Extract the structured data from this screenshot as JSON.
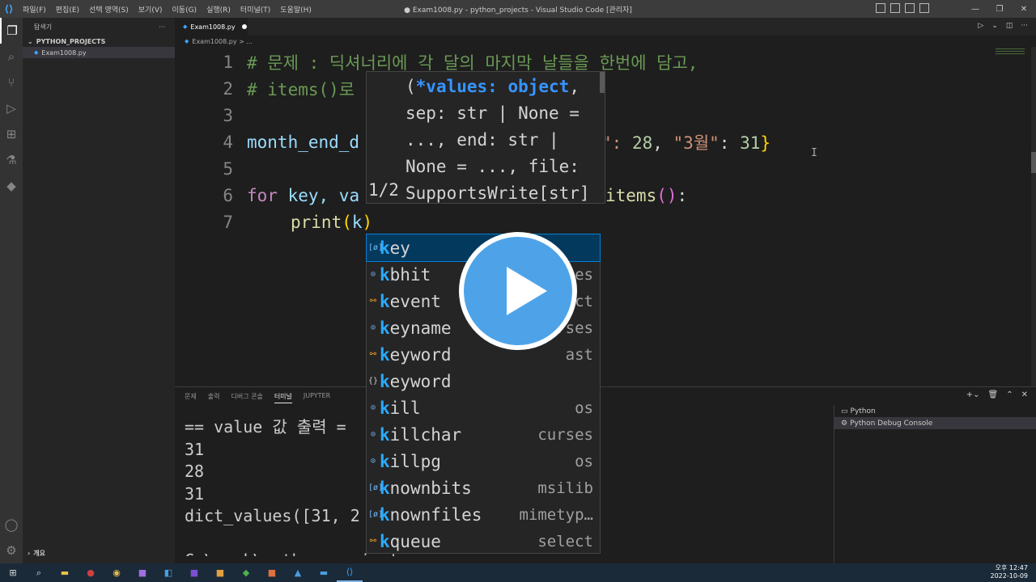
{
  "window": {
    "menu": [
      "파일(F)",
      "편집(E)",
      "선택 영역(S)",
      "보기(V)",
      "이동(G)",
      "실행(R)",
      "터미널(T)",
      "도움말(H)"
    ],
    "title": "● Exam1008.py - python_projects - Visual Studio Code [관리자]"
  },
  "sidebar": {
    "title": "탐색기",
    "more": "···",
    "folder": "PYTHON_PROJECTS",
    "file": "Exam1008.py",
    "outline": "개요"
  },
  "editor": {
    "tab_label": "Exam1008.py",
    "breadcrumb": "Exam1008.py > ...",
    "lines": [
      {
        "num": "1",
        "text": "# 문제 : 딕셔너리에 각 달의 마지막 날들을 한번에 담고,"
      },
      {
        "num": "2",
        "text": "# items()로"
      },
      {
        "num": "3",
        "text": ""
      },
      {
        "num": "4",
        "a": "month_end_d",
        "b": "\": ",
        "n1": "28",
        "c": ", ",
        "s": "\"3월\"",
        "d": ": ",
        "n2": "31",
        "e": "}"
      },
      {
        "num": "5",
        "text": ""
      },
      {
        "num": "6",
        "kw": "for",
        "rest1": " key, va",
        "rest2": "items",
        "paren": "()",
        "colon": ":"
      },
      {
        "num": "7",
        "fn": "print",
        "p1": "(",
        "arg": "k",
        "p2": ")"
      }
    ]
  },
  "signature_help": {
    "lines": [
      "(*values: object,",
      "sep: str | None =",
      "..., end: str |",
      "None = ..., file:",
      "SupportsWrite[str]"
    ],
    "bold_part": "*values: object",
    "counter": "1/2"
  },
  "suggestions": [
    {
      "match": "k",
      "rest": "ey",
      "source": "",
      "kind": "var"
    },
    {
      "match": "k",
      "rest": "bhit",
      "source": "curses",
      "kind": "fn"
    },
    {
      "match": "k",
      "rest": "event",
      "source": "select",
      "kind": "cls"
    },
    {
      "match": "k",
      "rest": "eyname",
      "source": "curses",
      "kind": "fn"
    },
    {
      "match": "k",
      "rest": "eyword",
      "source": "ast",
      "kind": "cls"
    },
    {
      "match": "k",
      "rest": "eyword",
      "source": "",
      "kind": "mod"
    },
    {
      "match": "k",
      "rest": "ill",
      "source": "os",
      "kind": "fn"
    },
    {
      "match": "k",
      "rest": "illchar",
      "source": "curses",
      "kind": "fn"
    },
    {
      "match": "k",
      "rest": "illpg",
      "source": "os",
      "kind": "fn"
    },
    {
      "match": "k",
      "rest": "nownbits",
      "source": "msilib",
      "kind": "var"
    },
    {
      "match": "k",
      "rest": "nownfiles",
      "source": "mimetyp…",
      "kind": "var"
    },
    {
      "match": "k",
      "rest": "queue",
      "source": "select",
      "kind": "cls"
    }
  ],
  "panel": {
    "tabs": [
      "문제",
      "출력",
      "디버그 콘솔",
      "터미널",
      "JUPYTER"
    ],
    "active_tab": "터미널",
    "terminal_lines": [
      "== value 값 출력 =",
      "31",
      "28",
      "31",
      "dict_values([31, 2",
      "",
      "C:\\work\\python_projects>"
    ],
    "terminals": [
      "Python",
      "Python Debug Console"
    ]
  },
  "taskbar": {
    "time": "오후 12:47",
    "date": "2022-10-09"
  },
  "colors": {
    "accent": "#007fd4",
    "play_button": "#4ea3e8",
    "comment": "#6a9955",
    "keyword": "#c586c0"
  }
}
